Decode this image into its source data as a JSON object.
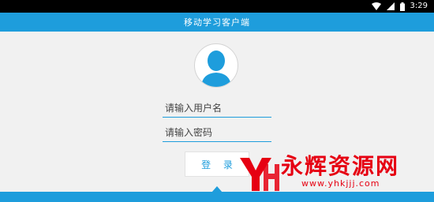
{
  "status_bar": {
    "time": "3:29",
    "icons": [
      "wifi-icon",
      "signal-icon",
      "battery-icon"
    ]
  },
  "header": {
    "title": "移动学习客户端"
  },
  "login_form": {
    "avatar_icon": "user-avatar-icon",
    "username": {
      "value": "",
      "placeholder": "请输入用户名"
    },
    "password": {
      "value": "",
      "placeholder": "请输入密码"
    },
    "submit_label": "登 录"
  },
  "watermark": {
    "title": "永辉资源网",
    "url": "www.yhkjjj.com"
  },
  "colors": {
    "accent": "#1e9ddc",
    "status_bar_bg": "#000000",
    "page_bg": "#f1f1f1",
    "watermark": "#e60012"
  }
}
